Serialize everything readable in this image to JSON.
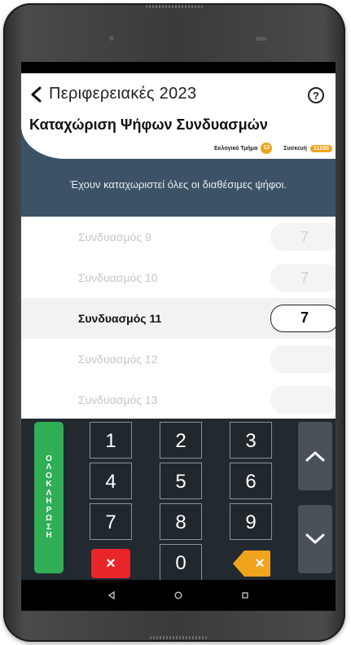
{
  "header": {
    "title": "Περιφερειακές 2023",
    "subtitle": "Καταχώριση Ψήφων Συνδυασμών",
    "help_glyph": "?",
    "section_label": "Εκλογικό Τμήμα",
    "section_value": "12",
    "device_label": "Συσκευή",
    "device_value": "11200"
  },
  "banner": {
    "message": "Έχουν καταχωριστεί όλες οι διαθέσιμες ψήφοι."
  },
  "list": {
    "items": [
      {
        "label": "Συνδυασμός 9",
        "value": "7",
        "active": false
      },
      {
        "label": "Συνδυασμός 10",
        "value": "7",
        "active": false
      },
      {
        "label": "Συνδυασμός 11",
        "value": "7",
        "active": true
      },
      {
        "label": "Συνδυασμός 12",
        "value": "",
        "active": false
      },
      {
        "label": "Συνδυασμός 13",
        "value": "",
        "active": false
      }
    ]
  },
  "keypad": {
    "submit_label": "ΟΛΟΚΛΗΡΩΣΗ",
    "keys": [
      "1",
      "2",
      "3",
      "4",
      "5",
      "6",
      "7",
      "8",
      "9"
    ],
    "zero": "0",
    "clear_glyph": "×",
    "backspace_glyph": "×"
  },
  "icons": {
    "back": "chevron-left-icon",
    "help": "help-icon",
    "up": "chevron-up-icon",
    "down": "chevron-down-icon",
    "nav_back": "triangle-back-icon",
    "nav_home": "circle-home-icon",
    "nav_recents": "square-recents-icon"
  },
  "colors": {
    "header_dark": "#3c5266",
    "accent_orange": "#f0a31c",
    "submit_green": "#2fae55",
    "clear_red": "#e8262a",
    "keypad_bg": "#222a30"
  }
}
